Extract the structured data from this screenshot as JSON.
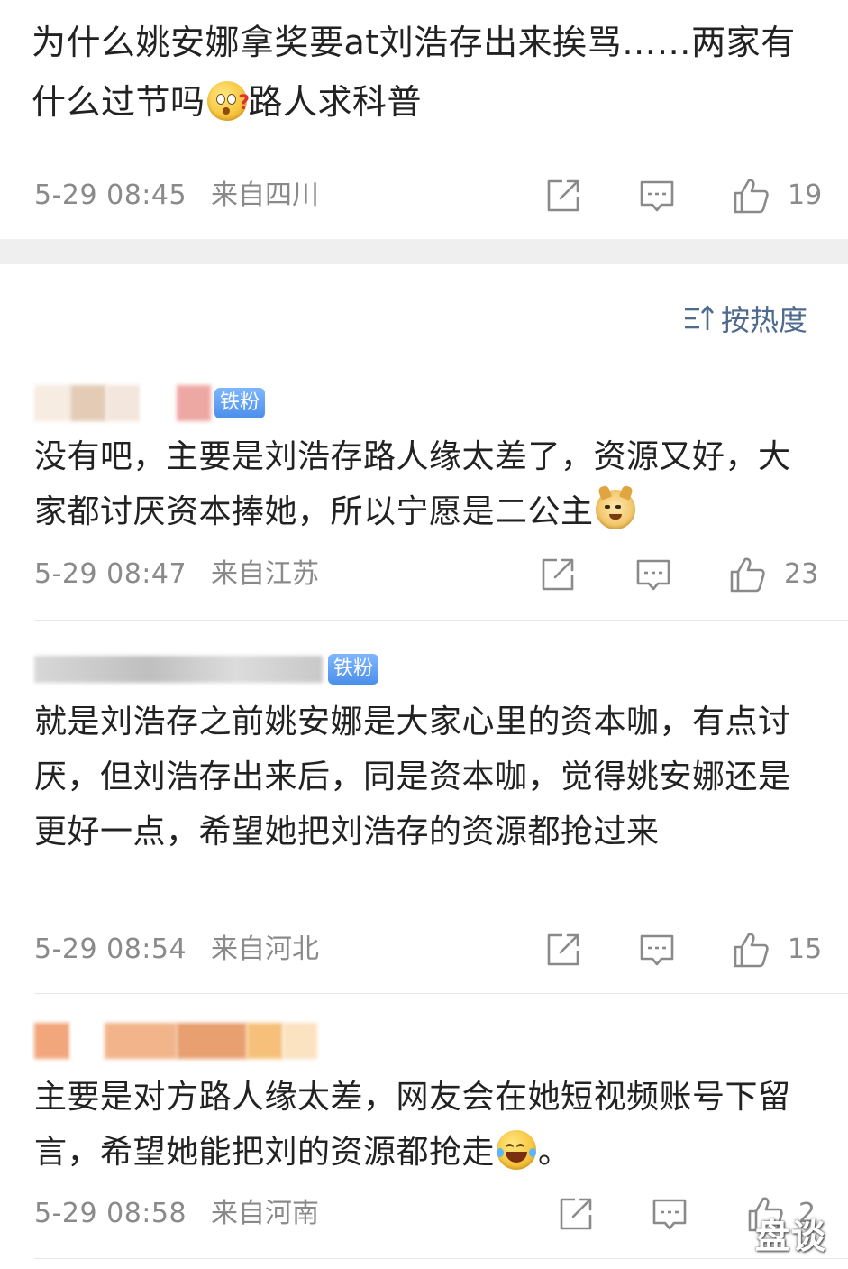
{
  "post": {
    "text": "为什么姚安娜拿奖要at刘浩存出来挨骂……两家有什么过节吗",
    "text_after_emoji": "路人求科普",
    "time": "5-29 08:45",
    "location": "来自四川",
    "likes": "19"
  },
  "sort": {
    "label": "按热度"
  },
  "comments": [
    {
      "badge": "铁粉",
      "text": "没有吧，主要是刘浩存路人缘太差了，资源又好，大家都讨厌资本捧她，所以宁愿是二公主",
      "time": "5-29 08:47",
      "location": "来自江苏",
      "likes": "23"
    },
    {
      "badge": "铁粉",
      "text": "就是刘浩存之前姚安娜是大家心里的资本咖，有点讨厌，但刘浩存出来后，同是资本咖，觉得姚安娜还是更好一点，希望她把刘浩存的资源都抢过来",
      "time": "5-29 08:54",
      "location": "来自河北",
      "likes": "15"
    },
    {
      "badge": "",
      "text": "主要是对方路人缘太差，网友会在她短视频账号下留言，希望她能把刘的资源都抢走",
      "text_after_emoji": "。",
      "time": "5-29 08:58",
      "location": "来自河南",
      "likes": "2"
    }
  ],
  "watermark": "盘谈"
}
